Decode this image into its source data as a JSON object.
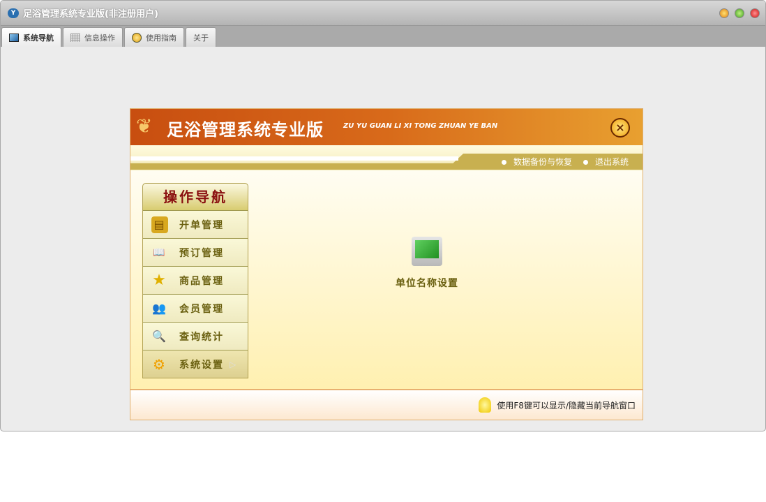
{
  "window": {
    "title": "足浴管理系统专业版(非注册用户)",
    "logo": "Y"
  },
  "tabs": [
    {
      "label": "系统导航",
      "icon": "monitor-icon"
    },
    {
      "label": "信息操作",
      "icon": "grid-icon"
    },
    {
      "label": "使用指南",
      "icon": "help-icon"
    },
    {
      "label": "关于"
    }
  ],
  "panel": {
    "title": "足浴管理系统专业版",
    "subtitle": "ZU YU GUAN LI XI TONG ZHUAN YE BAN",
    "close": "×",
    "links": [
      "数据备份与恢复",
      "退出系统"
    ],
    "nav_title": "操作导航",
    "nav_items": [
      {
        "label": "开单管理",
        "icon": "▤"
      },
      {
        "label": "预订管理",
        "icon": "📖"
      },
      {
        "label": "商品管理",
        "icon": "★"
      },
      {
        "label": "会员管理",
        "icon": "👥"
      },
      {
        "label": "查询统计",
        "icon": "🔍"
      },
      {
        "label": "系统设置",
        "icon": "⚙",
        "arrow": "▷"
      }
    ],
    "center_item": "单位名称设置",
    "footer": "使用F8键可以显示/隐藏当前导航窗口"
  },
  "colors": {
    "accent": "#d86a1a",
    "nav_text": "#6a6010",
    "nav_title": "#8a1010"
  }
}
